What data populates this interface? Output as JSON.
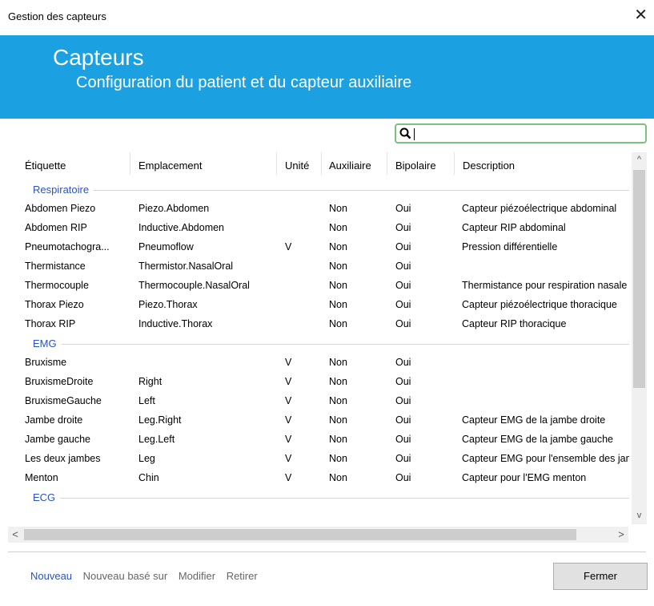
{
  "window": {
    "title": "Gestion des capteurs",
    "close_glyph": "✕"
  },
  "banner": {
    "title": "Capteurs",
    "subtitle": "Configuration du patient et du capteur auxiliaire"
  },
  "search": {
    "value": "",
    "placeholder": ""
  },
  "columns": [
    "Étiquette",
    "Emplacement",
    "Unité",
    "Auxiliaire",
    "Bipolaire",
    "Description"
  ],
  "groups": [
    {
      "name": "Respiratoire",
      "rows": [
        [
          "Abdomen Piezo",
          "Piezo.Abdomen",
          "",
          "Non",
          "Oui",
          "Capteur piézoélectrique abdominal"
        ],
        [
          "Abdomen RIP",
          "Inductive.Abdomen",
          "",
          "Non",
          "Oui",
          "Capteur RIP abdominal"
        ],
        [
          "Pneumotachogra...",
          "Pneumoflow",
          "V",
          "Non",
          "Oui",
          "Pression différentielle"
        ],
        [
          "Thermistance",
          "Thermistor.NasalOral",
          "",
          "Non",
          "Oui",
          ""
        ],
        [
          "Thermocouple",
          "Thermocouple.NasalOral",
          "",
          "Non",
          "Oui",
          "Thermistance pour respiration nasale"
        ],
        [
          "Thorax Piezo",
          "Piezo.Thorax",
          "",
          "Non",
          "Oui",
          "Capteur piézoélectrique thoracique"
        ],
        [
          "Thorax RIP",
          "Inductive.Thorax",
          "",
          "Non",
          "Oui",
          "Capteur RIP thoracique"
        ]
      ]
    },
    {
      "name": "EMG",
      "rows": [
        [
          "Bruxisme",
          "",
          "V",
          "Non",
          "Oui",
          ""
        ],
        [
          "BruxismeDroite",
          "Right",
          "V",
          "Non",
          "Oui",
          ""
        ],
        [
          "BruxismeGauche",
          "Left",
          "V",
          "Non",
          "Oui",
          ""
        ],
        [
          "Jambe droite",
          "Leg.Right",
          "V",
          "Non",
          "Oui",
          "Capteur EMG de la jambe droite"
        ],
        [
          "Jambe gauche",
          "Leg.Left",
          "V",
          "Non",
          "Oui",
          "Capteur EMG de la jambe gauche"
        ],
        [
          "Les deux jambes",
          "Leg",
          "V",
          "Non",
          "Oui",
          "Capteur EMG pour l'ensemble des jambes"
        ],
        [
          "Menton",
          "Chin",
          "V",
          "Non",
          "Oui",
          "Capteur pour l'EMG menton"
        ]
      ]
    },
    {
      "name": "ECG",
      "rows": []
    }
  ],
  "footer": {
    "links": [
      "Nouveau",
      "Nouveau basé sur",
      "Modifier",
      "Retirer"
    ],
    "close_button": "Fermer"
  },
  "scroll_glyphs": {
    "up": "^",
    "down": "v",
    "left": "<",
    "right": ">"
  },
  "colors": {
    "accent": "#1ba1e2",
    "group_label": "#2c52c8",
    "search_border": "#7ec07e"
  }
}
